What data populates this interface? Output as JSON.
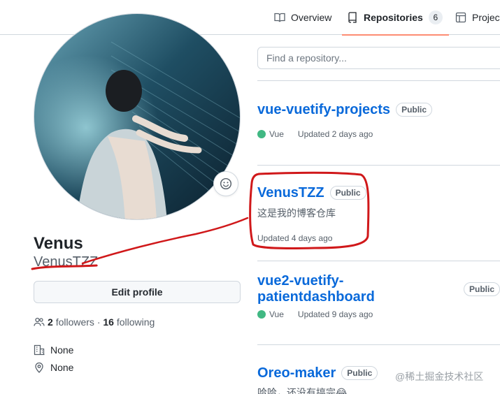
{
  "colors": {
    "accent": "#fd8c73",
    "link": "#0969da",
    "vue": "#41b883",
    "annotation": "#d0181a"
  },
  "nav": {
    "tabs": [
      {
        "label": "Overview",
        "icon": "book-icon"
      },
      {
        "label": "Repositories",
        "icon": "repo-icon",
        "count": "6",
        "selected": true
      },
      {
        "label": "Projects",
        "icon": "table-icon"
      }
    ]
  },
  "profile": {
    "full_name": "Venus",
    "username": "VenusTZZ",
    "edit_label": "Edit profile",
    "followers_count": "2",
    "followers_label": "followers",
    "separator": "·",
    "following_count": "16",
    "following_label": "following",
    "organization": "None",
    "location": "None"
  },
  "search": {
    "placeholder": "Find a repository..."
  },
  "repos": [
    {
      "name": "vue-vuetify-projects",
      "visibility": "Public",
      "language": "Vue",
      "updated": "Updated 2 days ago"
    },
    {
      "name": "VenusTZZ",
      "visibility": "Public",
      "description": "这是我的博客仓库",
      "updated": "Updated 4 days ago"
    },
    {
      "name": "vue2-vuetify-patientdashboard",
      "visibility": "Public",
      "language": "Vue",
      "updated": "Updated 9 days ago"
    },
    {
      "name": "Oreo-maker",
      "visibility": "Public",
      "description": "哈哈，还没有搞完😂"
    }
  ],
  "watermark": "@稀土掘金技术社区"
}
